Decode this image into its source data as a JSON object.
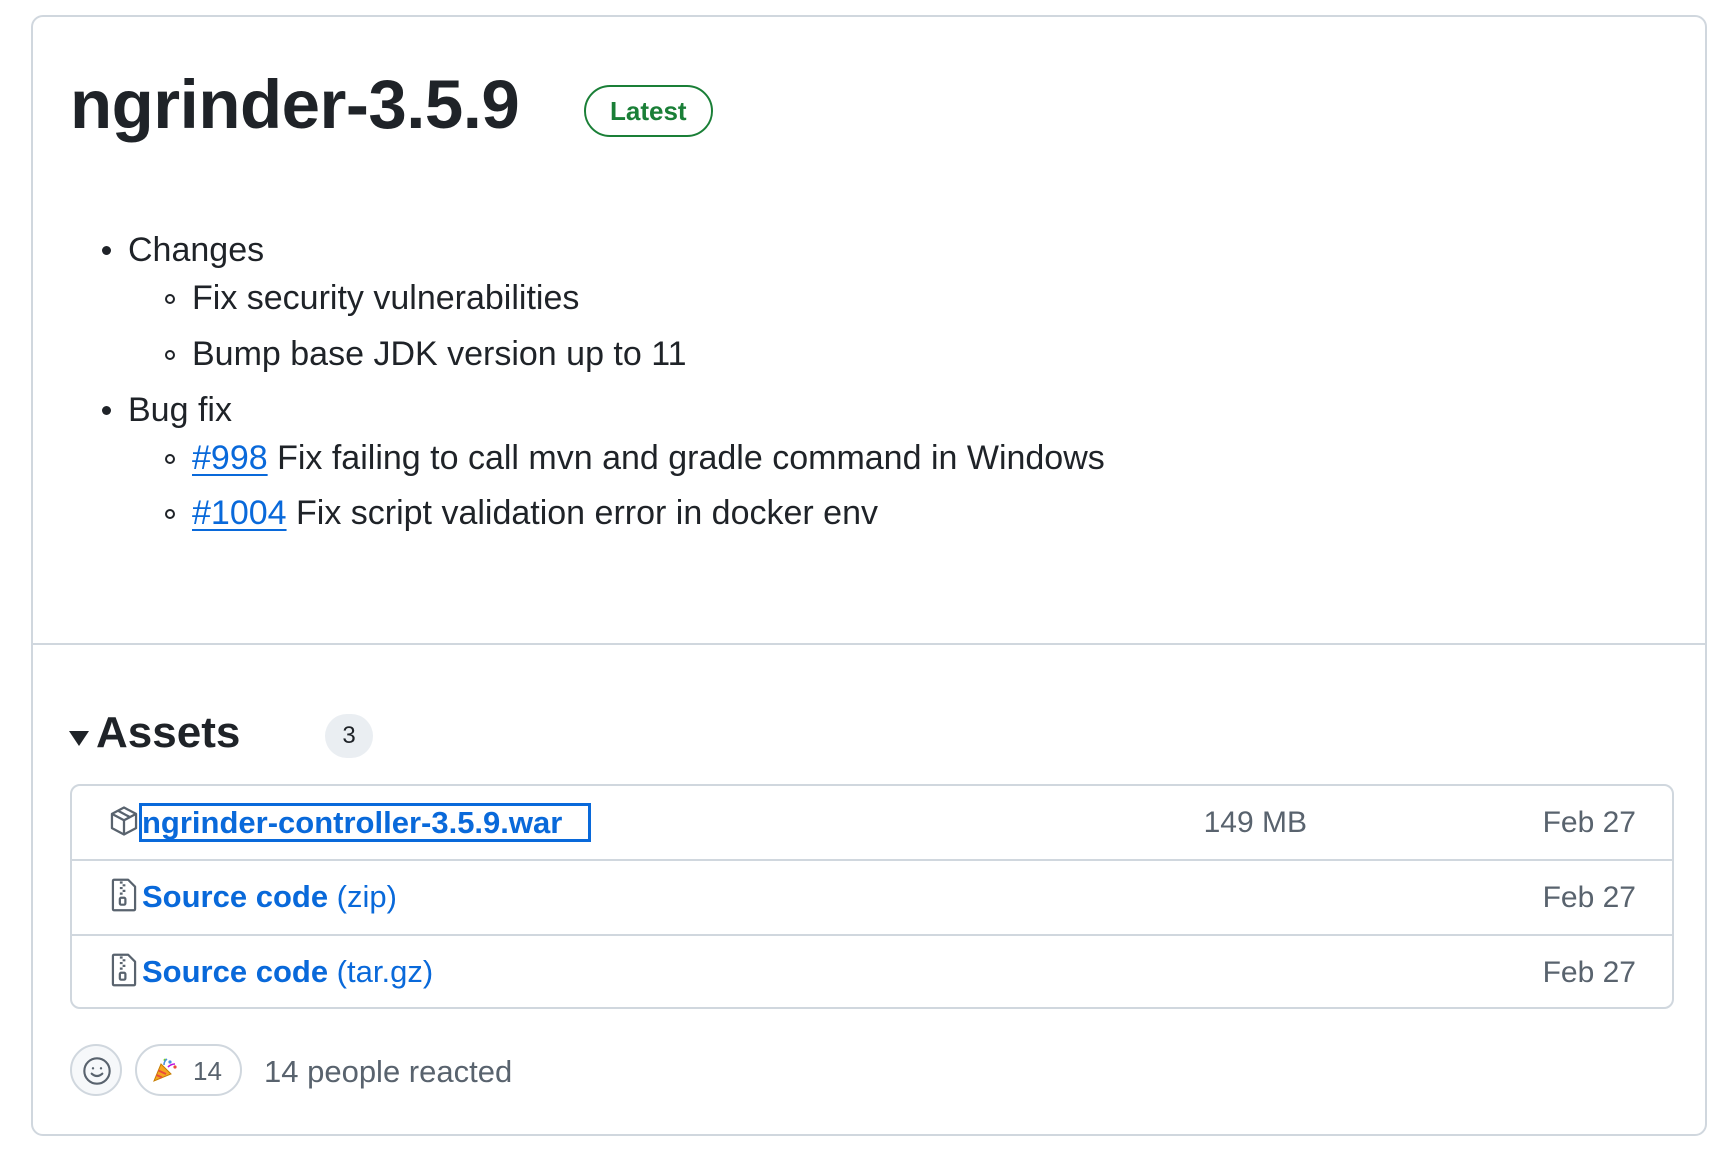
{
  "release": {
    "title": "ngrinder-3.5.9",
    "badge": "Latest"
  },
  "notes": {
    "sections": [
      {
        "label": "Changes",
        "items": [
          {
            "text": "Fix security vulnerabilities"
          },
          {
            "text": "Bump base JDK version up to 11"
          }
        ]
      },
      {
        "label": "Bug fix",
        "items": [
          {
            "link": "#998",
            "text": " Fix failing to call mvn and gradle command in Windows"
          },
          {
            "link": "#1004",
            "text": " Fix script validation error in docker env"
          }
        ]
      }
    ]
  },
  "assets": {
    "heading": "Assets",
    "count": "3",
    "items": [
      {
        "icon": "package-icon",
        "name": "ngrinder-controller-3.5.9.war",
        "suffix": "",
        "size": "149 MB",
        "date": "Feb 27"
      },
      {
        "icon": "file-zip-icon",
        "name": "Source code",
        "suffix": " (zip)",
        "size": "",
        "date": "Feb 27"
      },
      {
        "icon": "file-zip-icon",
        "name": "Source code",
        "suffix": " (tar.gz)",
        "size": "",
        "date": "Feb 27"
      }
    ]
  },
  "reactions": {
    "picker_icon": "smiley-icon",
    "items": [
      {
        "emoji": "tada",
        "count": "14"
      }
    ],
    "summary": "14 people reacted"
  },
  "colors": {
    "link": "#0969da",
    "badge_green": "#1a7f37",
    "border": "#d0d7de",
    "muted": "#59636e"
  }
}
